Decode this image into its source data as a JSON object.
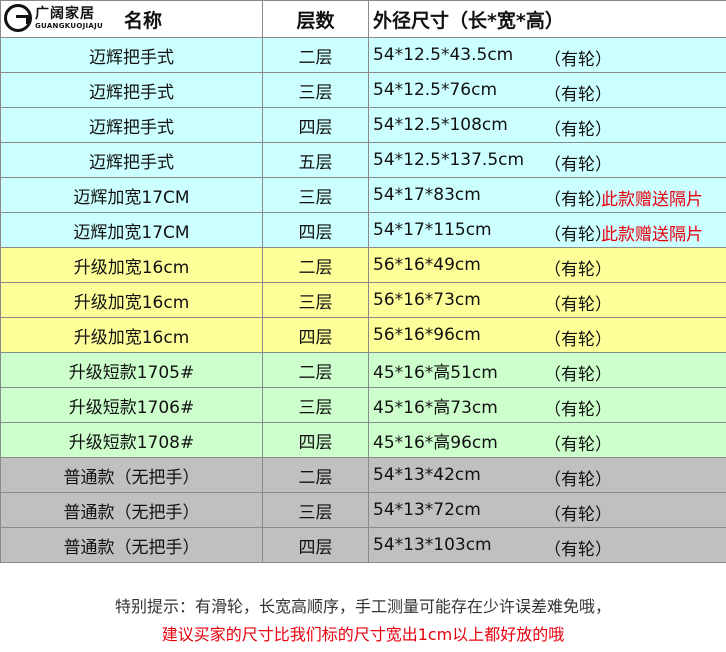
{
  "logo": {
    "cn": "广阔家居",
    "en": "GUANGKUOJIAJU"
  },
  "header": {
    "name": "名称",
    "layers": "层数",
    "size": "外径尺寸（长*宽*高）"
  },
  "rows": [
    {
      "name": "迈辉把手式",
      "layers": "二层",
      "size": "54*12.5*43.5cm",
      "wheel": "（有轮）",
      "note": "",
      "color": "cyan"
    },
    {
      "name": "迈辉把手式",
      "layers": "三层",
      "size": "54*12.5*76cm",
      "wheel": "（有轮）",
      "note": "",
      "color": "cyan"
    },
    {
      "name": "迈辉把手式",
      "layers": "四层",
      "size": "54*12.5*108cm",
      "wheel": "（有轮）",
      "note": "",
      "color": "cyan"
    },
    {
      "name": "迈辉把手式",
      "layers": "五层",
      "size": "54*12.5*137.5cm",
      "wheel": "（有轮）",
      "note": "",
      "color": "cyan"
    },
    {
      "name": "迈辉加宽17CM",
      "layers": "三层",
      "size": "54*17*83cm",
      "wheel": "（有轮）",
      "note": "此款赠送隔片",
      "color": "cyan"
    },
    {
      "name": "迈辉加宽17CM",
      "layers": "四层",
      "size": "54*17*115cm",
      "wheel": "（有轮）",
      "note": "此款赠送隔片",
      "color": "cyan"
    },
    {
      "name": "升级加宽16cm",
      "layers": "二层",
      "size": "56*16*49cm",
      "wheel": "（有轮）",
      "note": "",
      "color": "yellow"
    },
    {
      "name": "升级加宽16cm",
      "layers": "三层",
      "size": "56*16*73cm",
      "wheel": "（有轮）",
      "note": "",
      "color": "yellow"
    },
    {
      "name": "升级加宽16cm",
      "layers": "四层",
      "size": "56*16*96cm",
      "wheel": "（有轮）",
      "note": "",
      "color": "yellow"
    },
    {
      "name": "升级短款1705#",
      "layers": "二层",
      "size": "45*16*高51cm",
      "wheel": "（有轮）",
      "note": "",
      "color": "green"
    },
    {
      "name": "升级短款1706#",
      "layers": "三层",
      "size": "45*16*高73cm",
      "wheel": "（有轮）",
      "note": "",
      "color": "green"
    },
    {
      "name": "升级短款1708#",
      "layers": "四层",
      "size": "45*16*高96cm",
      "wheel": "（有轮）",
      "note": "",
      "color": "green"
    },
    {
      "name": "普通款（无把手）",
      "layers": "二层",
      "size": "54*13*42cm",
      "wheel": "（有轮）",
      "note": "",
      "color": "gray"
    },
    {
      "name": "普通款（无把手）",
      "layers": "三层",
      "size": "54*13*72cm",
      "wheel": "（有轮）",
      "note": "",
      "color": "gray"
    },
    {
      "name": "普通款（无把手）",
      "layers": "四层",
      "size": "54*13*103cm",
      "wheel": "（有轮）",
      "note": "",
      "color": "gray"
    }
  ],
  "footer": {
    "line1": "特别提示：有滑轮，长宽高顺序，手工测量可能存在少许误差难免哦，",
    "line2": "建议买家的尺寸比我们标的尺寸宽出1cm以上都好放的哦"
  },
  "colors": {
    "cyan": "#ccffff",
    "yellow": "#ffff99",
    "green": "#ccffcc",
    "gray": "#c0c0c0",
    "red_text": "#e8000f"
  }
}
